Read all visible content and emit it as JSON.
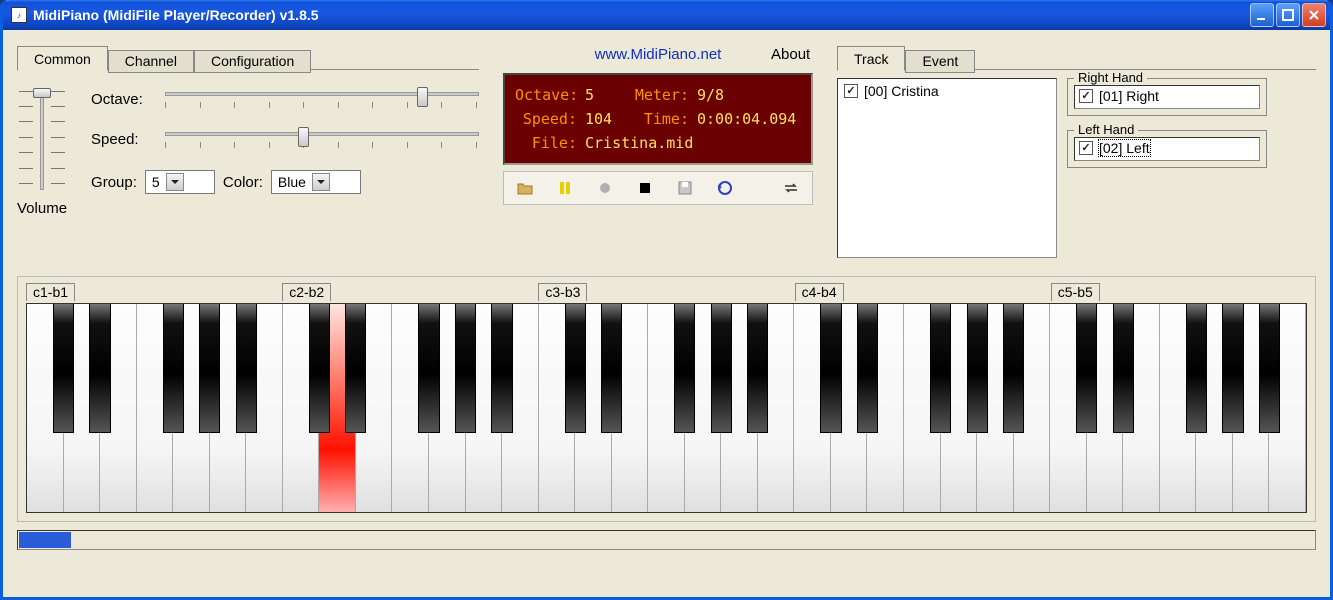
{
  "window": {
    "title": "MidiPiano (MidiFile Player/Recorder) v1.8.5"
  },
  "tabs_left": {
    "active": "Common",
    "items": [
      "Common",
      "Channel",
      "Configuration"
    ]
  },
  "tabs_right": {
    "active": "Track",
    "items": [
      "Track",
      "Event"
    ]
  },
  "about_label": "About",
  "link": "www.MidiPiano.net",
  "volume": {
    "label": "Volume"
  },
  "sliders": {
    "octave": {
      "label": "Octave:",
      "position_pct": 82
    },
    "speed": {
      "label": "Speed:",
      "position_pct": 44
    }
  },
  "combos": {
    "group": {
      "label": "Group:",
      "value": "5"
    },
    "color": {
      "label": "Color:",
      "value": "Blue"
    }
  },
  "lcd": {
    "octave": {
      "label": "Octave:",
      "value": "5"
    },
    "meter": {
      "label": "Meter:",
      "value": "9/8"
    },
    "speed": {
      "label": "Speed:",
      "value": "104"
    },
    "time": {
      "label": "Time:",
      "value": "0:00:04.094"
    },
    "file": {
      "label": "File:",
      "value": "Cristina.mid"
    }
  },
  "tracklist": {
    "items": [
      "[00] Cristina"
    ]
  },
  "right_hand": {
    "legend": "Right Hand",
    "items": [
      "[01] Right"
    ]
  },
  "left_hand": {
    "legend": "Left Hand",
    "items": [
      "[02] Left"
    ]
  },
  "octave_labels": [
    "c1-b1",
    "c2-b2",
    "c3-b3",
    "c4-b4",
    "c5-b5"
  ],
  "keyboard": {
    "white_count": 35,
    "pressed_white_index": 8
  },
  "progress_pct": 4
}
